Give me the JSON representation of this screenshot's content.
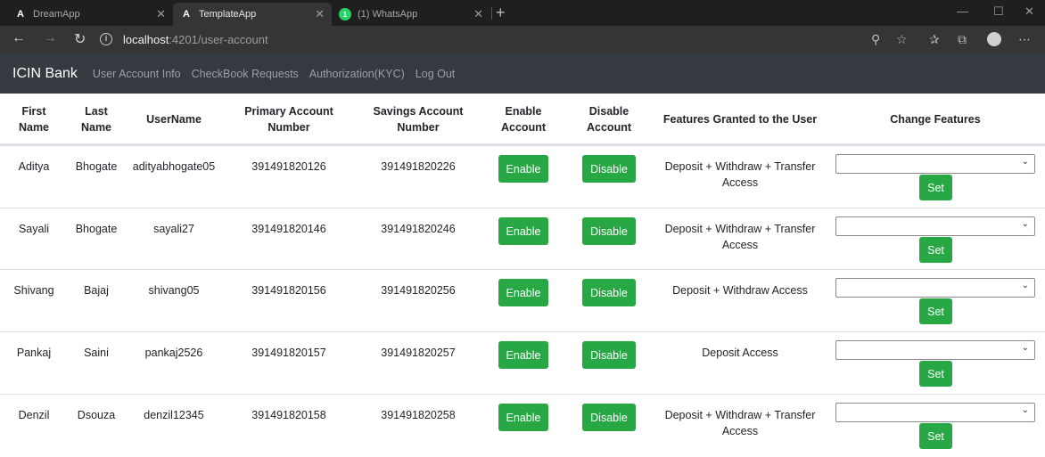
{
  "browser": {
    "tabs": [
      {
        "title": "DreamApp",
        "icon": "angular-icon"
      },
      {
        "title": "TemplateApp",
        "icon": "angular-icon"
      },
      {
        "title": "(1) WhatsApp",
        "icon": "whatsapp-icon"
      }
    ],
    "url_host": "localhost",
    "url_path": ":4201/user-account"
  },
  "navbar": {
    "brand": "ICIN Bank",
    "links": [
      "User Account Info",
      "CheckBook Requests",
      "Authorization(KYC)",
      "Log Out"
    ]
  },
  "table": {
    "headers": {
      "first_name_1": "First",
      "first_name_2": "Name",
      "last_name_1": "Last",
      "last_name_2": "Name",
      "username": "UserName",
      "primary_1": "Primary Account",
      "primary_2": "Number",
      "savings_1": "Savings Account",
      "savings_2": "Number",
      "enable_1": "Enable",
      "enable_2": "Account",
      "disable_1": "Disable",
      "disable_2": "Account",
      "features": "Features Granted to the User",
      "change": "Change Features"
    },
    "rows": [
      {
        "first": "Aditya",
        "last": "Bhogate",
        "username": "adityabhogate05",
        "primary": "391491820126",
        "savings": "391491820226",
        "features_1": "Deposit + Withdraw + Transfer",
        "features_2": "Access",
        "enable": "Enable",
        "disable": "Disable",
        "set": "Set",
        "select_value": ""
      },
      {
        "first": "Sayali",
        "last": "Bhogate",
        "username": "sayali27",
        "primary": "391491820146",
        "savings": "391491820246",
        "features_1": "Deposit + Withdraw + Transfer",
        "features_2": "Access",
        "enable": "Enable",
        "disable": "Disable",
        "set": "Set",
        "select_value": ""
      },
      {
        "first": "Shivang",
        "last": "Bajaj",
        "username": "shivang05",
        "primary": "391491820156",
        "savings": "391491820256",
        "features_1": "Deposit + Withdraw Access",
        "features_2": "",
        "enable": "Enable",
        "disable": "Disable",
        "set": "Set",
        "select_value": ""
      },
      {
        "first": "Pankaj",
        "last": "Saini",
        "username": "pankaj2526",
        "primary": "391491820157",
        "savings": "391491820257",
        "features_1": "Deposit Access",
        "features_2": "",
        "enable": "Enable",
        "disable": "Disable",
        "set": "Set",
        "select_value": ""
      },
      {
        "first": "Denzil",
        "last": "Dsouza",
        "username": "denzil12345",
        "primary": "391491820158",
        "savings": "391491820258",
        "features_1": "Deposit + Withdraw + Transfer",
        "features_2": "Access",
        "enable": "Enable",
        "disable": "Disable",
        "set": "Set",
        "select_value": ""
      }
    ]
  },
  "colors": {
    "navbar_bg": "#343a40",
    "button_green": "#28a745",
    "chrome_dark": "#1f1f1f"
  }
}
